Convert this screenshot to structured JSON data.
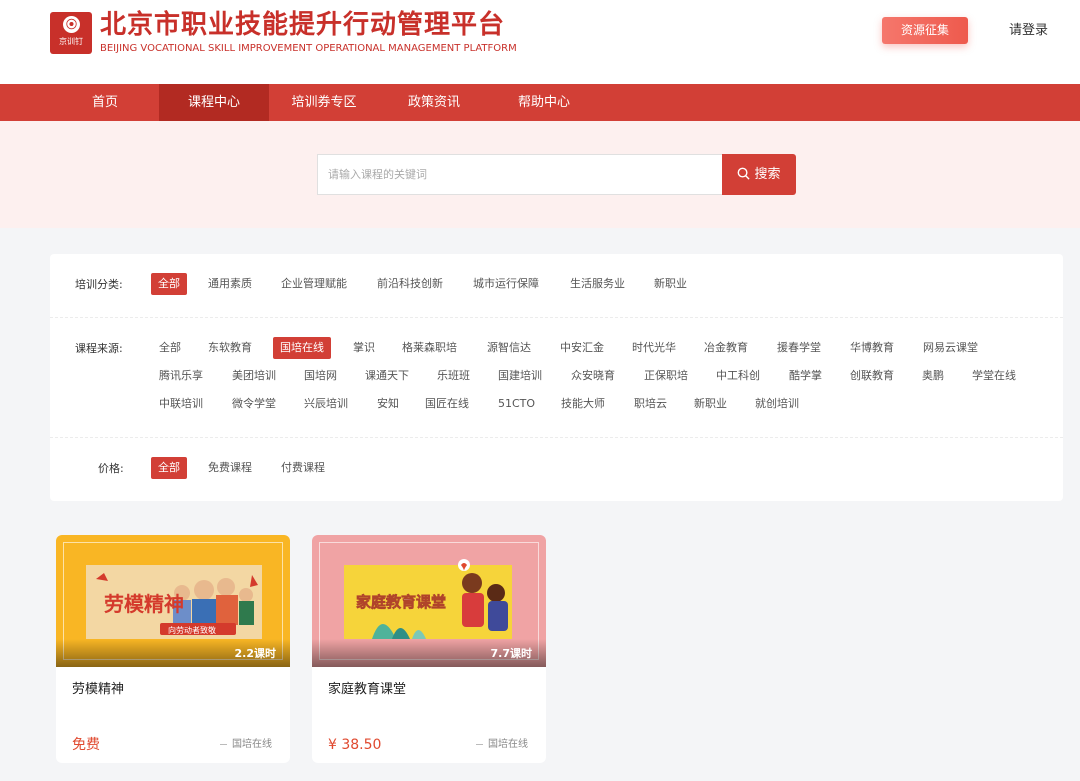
{
  "header": {
    "logo_text": "京训钉",
    "title": "北京市职业技能提升行动管理平台",
    "subtitle": "BEIJING VOCATIONAL SKILL IMPROVEMENT OPERATIONAL MANAGEMENT PLATFORM",
    "resource_button": "资源征集",
    "login": "请登录"
  },
  "nav": {
    "items": [
      {
        "label": "首页"
      },
      {
        "label": "课程中心"
      },
      {
        "label": "培训券专区"
      },
      {
        "label": "政策资讯"
      },
      {
        "label": "帮助中心"
      }
    ],
    "active": "课程中心"
  },
  "search": {
    "placeholder": "请输入课程的关键词",
    "button": "搜索"
  },
  "filters": {
    "category": {
      "label": "培训分类:",
      "options": [
        "全部",
        "通用素质",
        "企业管理赋能",
        "前沿科技创新",
        "城市运行保障",
        "生活服务业",
        "新职业"
      ],
      "selected": "全部"
    },
    "source": {
      "label": "课程来源:",
      "options": [
        "全部",
        "东软教育",
        "国培在线",
        "掌识",
        "格莱森职培",
        "源智信达",
        "中安汇金",
        "时代光华",
        "冶金教育",
        "援春学堂",
        "华博教育",
        "网易云课堂",
        "腾讯乐享",
        "美团培训",
        "国培网",
        "课通天下",
        "乐班班",
        "国建培训",
        "众安晓育",
        "正保职培",
        "中工科创",
        "酷学掌",
        "创联教育",
        "奥鹏",
        "学堂在线",
        "中联培训",
        "微令学堂",
        "兴辰培训",
        "安知",
        "国匠在线",
        "51CTO",
        "技能大师",
        "职培云",
        "新职业",
        "就创培训"
      ],
      "selected": "国培在线"
    },
    "price": {
      "label": "价格:",
      "options": [
        "全部",
        "免费课程",
        "付费课程"
      ],
      "selected": "全部"
    }
  },
  "courses": [
    {
      "title": "劳模精神",
      "thumb_text": "劳模精神",
      "thumb_banner": "向劳动者致敬",
      "lessons": "2.2课时",
      "price": "免费",
      "source": "国培在线"
    },
    {
      "title": "家庭教育课堂",
      "thumb_text": "家庭教育课堂",
      "lessons": "7.7课时",
      "price": "¥ 38.50",
      "source": "国培在线"
    }
  ],
  "colors": {
    "brand": "#d23f36",
    "nav_active": "#b22a22",
    "price": "#e0492f"
  }
}
